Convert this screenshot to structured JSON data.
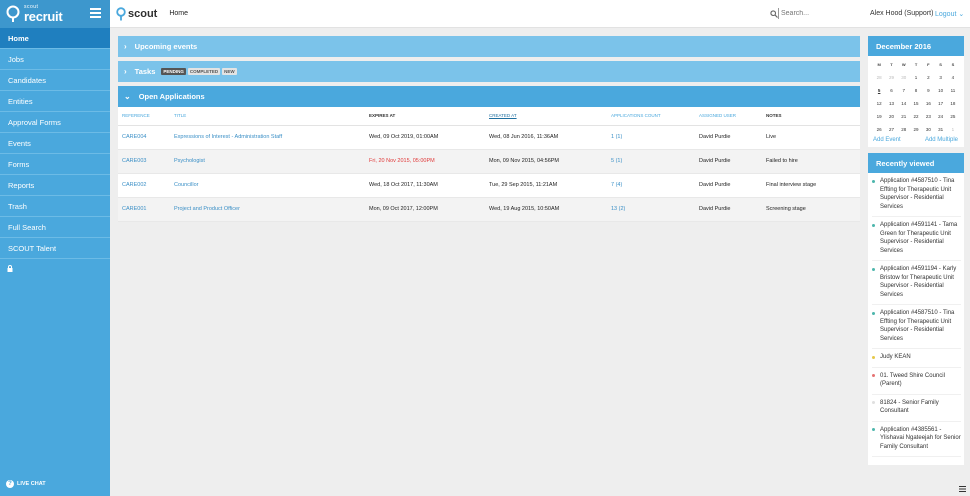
{
  "app": {
    "brand_top": "scout",
    "brand_main": "recruit",
    "topbar_logo": "scout",
    "breadcrumb": "Home",
    "search_placeholder": "Search...",
    "user": "Alex Hood (Support)",
    "logout": "Logout"
  },
  "sidebar": {
    "items": [
      {
        "label": "Home",
        "active": true
      },
      {
        "label": "Jobs"
      },
      {
        "label": "Candidates"
      },
      {
        "label": "Entities"
      },
      {
        "label": "Approval Forms"
      },
      {
        "label": "Events"
      },
      {
        "label": "Forms"
      },
      {
        "label": "Reports"
      },
      {
        "label": "Trash"
      },
      {
        "label": "Full Search"
      },
      {
        "label": "SCOUT Talent"
      }
    ],
    "live_chat": "LIVE CHAT"
  },
  "panels": {
    "upcoming": "Upcoming events",
    "tasks": "Tasks",
    "task_badges": {
      "pending": "PENDING",
      "completed": "COMPLETED",
      "new": "NEW"
    },
    "open_apps": "Open Applications"
  },
  "table": {
    "headers": {
      "reference": "REFERENCE",
      "title": "TITLE",
      "expires": "EXPIRES AT",
      "created": "CREATED AT",
      "count": "APPLICATIONS COUNT",
      "user": "ASSIGNED USER",
      "notes": "NOTES"
    },
    "rows": [
      {
        "reference": "CARE004",
        "title": "Expressions of Interest - Administration Staff",
        "expires": "Wed, 09 Oct 2019, 01:00AM",
        "created": "Wed, 08 Jun 2016, 11:36AM",
        "count": "1 (1)",
        "user": "David Purdie",
        "notes": "Live"
      },
      {
        "reference": "CARE003",
        "title": "Psychologist",
        "expires": "Fri, 20 Nov 2015, 05:00PM",
        "created": "Mon, 09 Nov 2015, 04:56PM",
        "count": "5 (1)",
        "user": "David Purdie",
        "notes": "Failed to hire"
      },
      {
        "reference": "CARE002",
        "title": "Councillor",
        "expires": "Wed, 18 Oct 2017, 11:30AM",
        "created": "Tue, 29 Sep 2015, 11:21AM",
        "count": "7 (4)",
        "user": "David Purdie",
        "notes": "Final interview stage"
      },
      {
        "reference": "CARE001",
        "title": "Project and Product Officer",
        "expires": "Mon, 09 Oct 2017, 12:00PM",
        "created": "Wed, 19 Aug 2015, 10:50AM",
        "count": "13 (2)",
        "user": "David Purdie",
        "notes": "Screening stage"
      }
    ]
  },
  "calendar": {
    "title": "December 2016",
    "dow": [
      "M",
      "T",
      "W",
      "T",
      "F",
      "S",
      "S"
    ],
    "days": [
      "28",
      "29",
      "30",
      "1",
      "2",
      "3",
      "4",
      "5",
      "6",
      "7",
      "8",
      "9",
      "10",
      "11",
      "12",
      "13",
      "14",
      "15",
      "16",
      "17",
      "18",
      "19",
      "20",
      "21",
      "22",
      "23",
      "24",
      "25",
      "26",
      "27",
      "28",
      "29",
      "30",
      "31",
      "1"
    ],
    "add_event": "Add Event",
    "add_multiple": "Add Multiple"
  },
  "recent": {
    "title": "Recently viewed",
    "items": [
      {
        "text": "Application #4587510 - Tina Effting for Therapeutic Unit Supervisor - Residential Services",
        "color": "#4db6ac"
      },
      {
        "text": "Application #4591141 - Tama Green for Therapeutic Unit Supervisor - Residential Services",
        "color": "#4db6ac"
      },
      {
        "text": "Application #4591194 - Karly Bristow for Therapeutic Unit Supervisor - Residential Services",
        "color": "#4db6ac"
      },
      {
        "text": "Application #4587510 - Tina Effting for Therapeutic Unit Supervisor - Residential Services",
        "color": "#4db6ac"
      },
      {
        "text": "Judy KEAN",
        "color": "#e6c84a"
      },
      {
        "text": "01. Tweed Shire Council (Parent)",
        "color": "#e57373"
      },
      {
        "text": "81824 - Senior Family Consultant",
        "color": "#e0e0e0"
      },
      {
        "text": "Application #4385561 - Ylishavai Ngateejah for Senior Family Consultant",
        "color": "#4db6ac"
      }
    ]
  },
  "colors": {
    "accent": "#4aa8dd",
    "accent_dark": "#1f7fbf",
    "panel_light": "#7bc3ea",
    "overdue": "#e03a3a"
  }
}
